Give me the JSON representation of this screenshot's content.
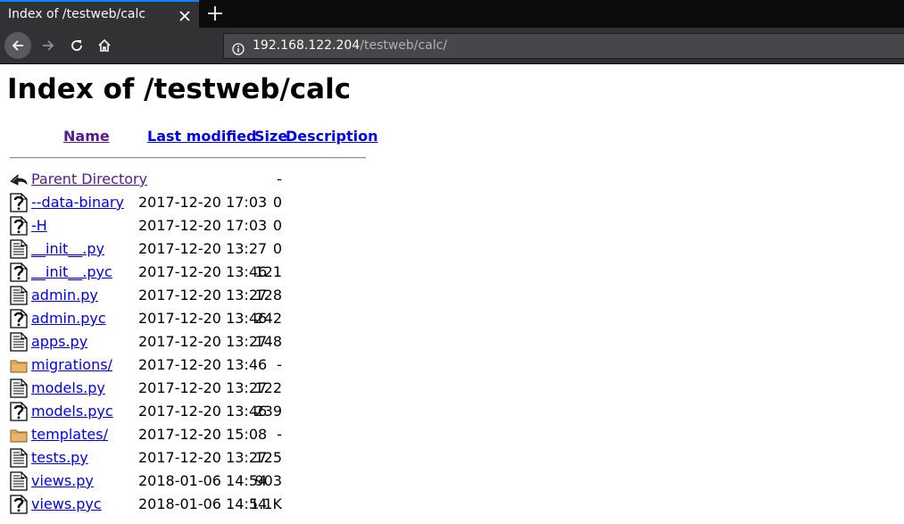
{
  "browser": {
    "tab_title": "Index of /testweb/calc",
    "url_host": "192.168.122.204",
    "url_path": "/testweb/calc/",
    "accent_color": "#0a84ff"
  },
  "page": {
    "title": "Index of /testweb/calc",
    "headers": {
      "name": "Name",
      "last_modified": "Last modified",
      "size": "Size",
      "description": "Description"
    },
    "entries": [
      {
        "name": "Parent Directory",
        "modified": "",
        "size": "-",
        "icon": "back-arrow-icon",
        "visited": true
      },
      {
        "name": "--data-binary",
        "modified": "2017-12-20 17:03",
        "size": "0",
        "icon": "unknown-file-icon"
      },
      {
        "name": "-H",
        "modified": "2017-12-20 17:03",
        "size": "0",
        "icon": "unknown-file-icon"
      },
      {
        "name": "__init__.py",
        "modified": "2017-12-20 13:27",
        "size": "0",
        "icon": "text-file-icon"
      },
      {
        "name": "__init__.pyc",
        "modified": "2017-12-20 13:46",
        "size": "121",
        "icon": "unknown-file-icon"
      },
      {
        "name": "admin.py",
        "modified": "2017-12-20 13:27",
        "size": "128",
        "icon": "text-file-icon"
      },
      {
        "name": "admin.pyc",
        "modified": "2017-12-20 13:46",
        "size": "242",
        "icon": "unknown-file-icon"
      },
      {
        "name": "apps.py",
        "modified": "2017-12-20 13:27",
        "size": "148",
        "icon": "text-file-icon"
      },
      {
        "name": "migrations/",
        "modified": "2017-12-20 13:46",
        "size": "-",
        "icon": "folder-icon"
      },
      {
        "name": "models.py",
        "modified": "2017-12-20 13:27",
        "size": "122",
        "icon": "text-file-icon"
      },
      {
        "name": "models.pyc",
        "modified": "2017-12-20 13:46",
        "size": "239",
        "icon": "unknown-file-icon"
      },
      {
        "name": "templates/",
        "modified": "2017-12-20 15:08",
        "size": "-",
        "icon": "folder-icon"
      },
      {
        "name": "tests.py",
        "modified": "2017-12-20 13:27",
        "size": "125",
        "icon": "text-file-icon"
      },
      {
        "name": "views.py",
        "modified": "2018-01-06 14:54",
        "size": "903",
        "icon": "text-file-icon"
      },
      {
        "name": "views.pyc",
        "modified": "2018-01-06 14:54",
        "size": "1.1K",
        "icon": "unknown-file-icon"
      }
    ]
  }
}
